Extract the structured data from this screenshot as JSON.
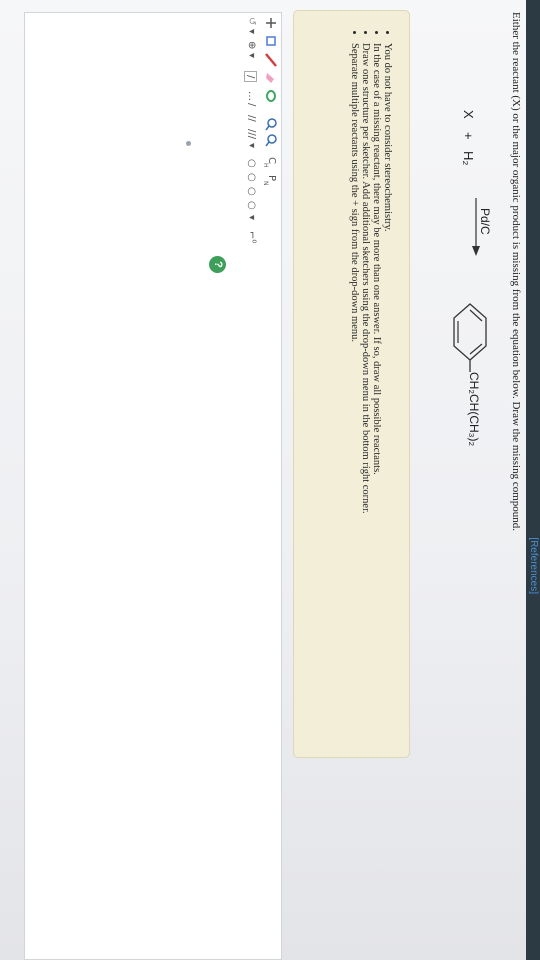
{
  "header": {
    "references_label": "[References]"
  },
  "question": {
    "text": "Either the reactant (X) or the major organic product is missing from the equation below. Draw the missing compound."
  },
  "equation": {
    "reactant": "X",
    "plus": "+",
    "reagent": "H₂",
    "catalyst": "Pd/C",
    "product_substituent": "CH₂CH(CH₃)₂"
  },
  "instructions": {
    "items": [
      "You do not have to consider stereochemistry.",
      "In the case of a missing reactant, there may be more than one answer. If so, draw all possible reactants.",
      "Draw one structure per sketcher. Add additional sketchers using the drop-down menu in the bottom right corner.",
      "Separate multiple reactants using the + sign from the drop-down menu."
    ]
  },
  "sketcher": {
    "toolbar": {
      "element_c": "C",
      "element_h": "H",
      "element_p": "P",
      "element_n": "N",
      "charge_plus": "⊕",
      "chain_label": "…",
      "bond_single": "/",
      "bond_double": "//",
      "bond_triple": "///",
      "ring_label": "○",
      "dropdown_label": "▾",
      "corner_label": "⌐⁰"
    },
    "help_label": "?"
  }
}
